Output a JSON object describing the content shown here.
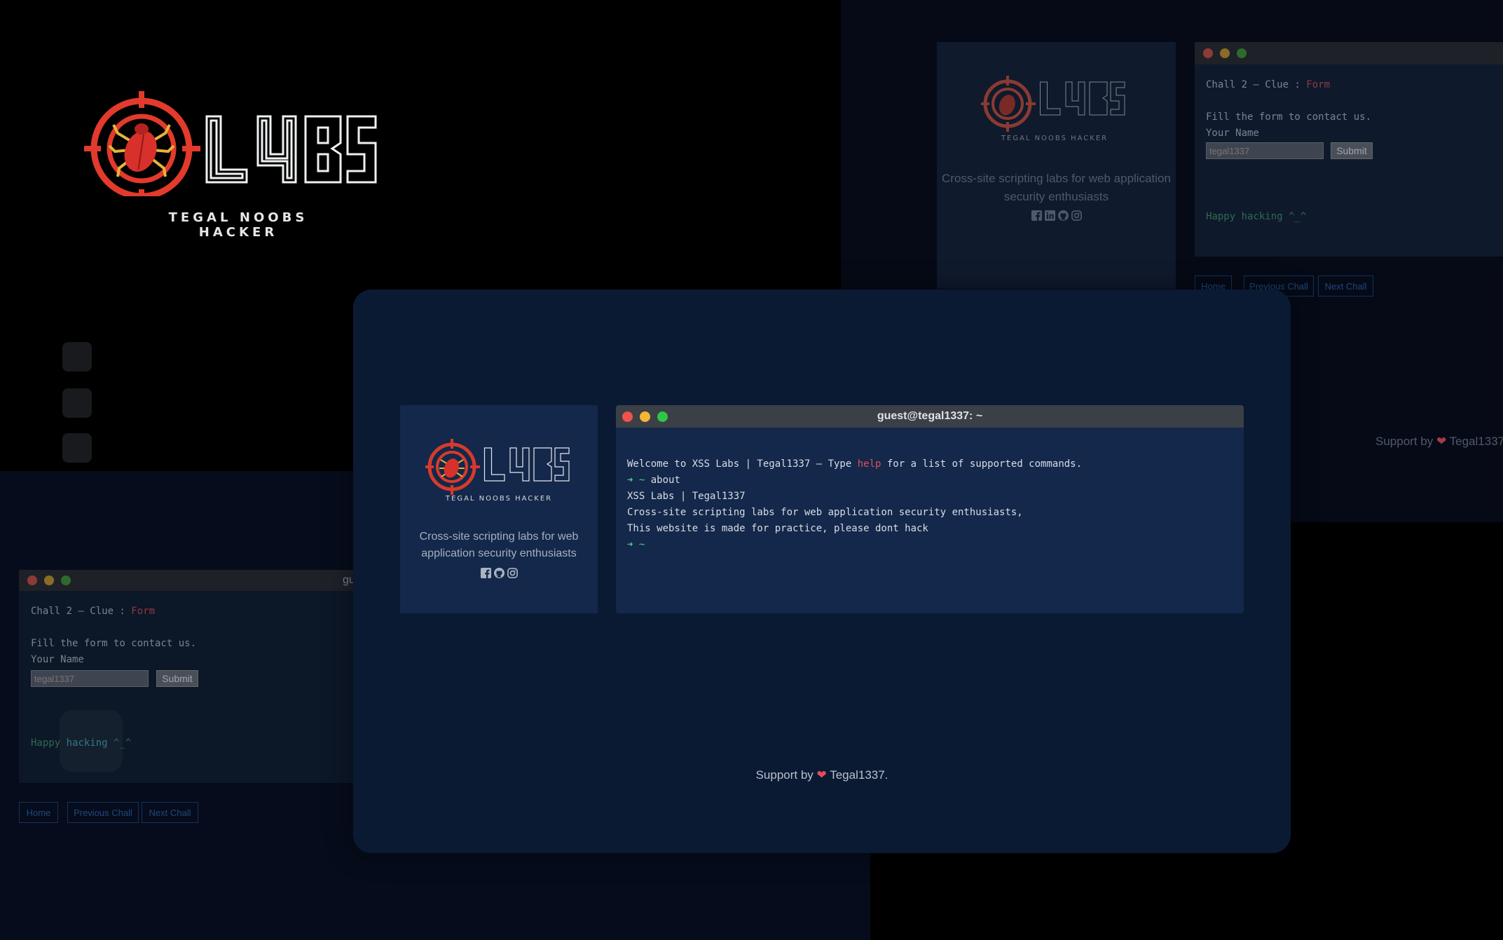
{
  "logo": {
    "word": "L4BS",
    "tagline": "TEGAL NOOBS HACKER"
  },
  "tagline_text": "Cross-site scripting labs for web application security enthusiasts",
  "social_icons": [
    "facebook-icon",
    "linkedin-icon",
    "github-icon",
    "instagram-icon"
  ],
  "main_terminal": {
    "title": "guest@tegal1337: ~",
    "welcome_prefix": "Welcome to XSS Labs | Tegal1337 – Type ",
    "welcome_help": "help",
    "welcome_suffix": " for a list of supported commands.",
    "prompt": "➜ ~",
    "command": "about",
    "output_1": "XSS Labs | Tegal1337",
    "output_2": "Cross-site scripting labs for web application security enthusiasts,",
    "output_3": "This website is made for practice, please dont hack"
  },
  "chall_window": {
    "title_cut": "gu",
    "clue_prefix": "Chall 2 – Clue : ",
    "clue_value": "Form",
    "instruction": "Fill the form to contact us.",
    "name_label": "Your Name",
    "name_placeholder": "tegal1337",
    "submit": "Submit",
    "happy_1": "Happy",
    "happy_2": "hacking",
    "happy_3": "^_^",
    "happy_full": "Happy hacking ^_^"
  },
  "nav": {
    "home": "Home",
    "previous": "Previous Chall",
    "next": "Next Chall"
  },
  "footer": {
    "support_by": "Support by",
    "author": "Tegal1337.",
    "author_cut": "Tegal1337"
  },
  "colors": {
    "accent_red": "#e84a5f",
    "prompt_green": "#4fd08a",
    "happy_green": "#3f9a6a",
    "link_blue": "#2f6fbf",
    "navy_card": "#0e1d38"
  }
}
